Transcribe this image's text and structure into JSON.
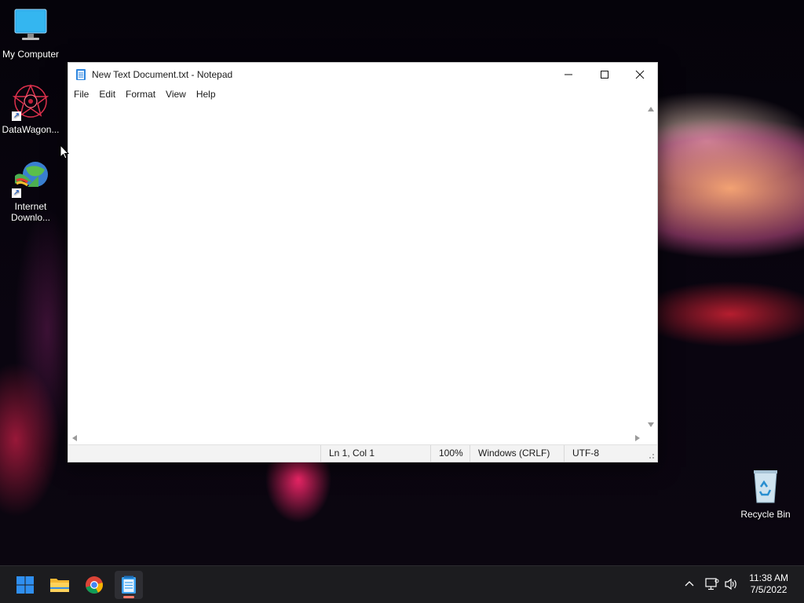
{
  "desktop": {
    "icons": [
      {
        "label": "My Computer",
        "icon": "monitor-icon"
      },
      {
        "label": "DataWagon...",
        "icon": "datawagon-icon"
      },
      {
        "label": "Internet Downlo...",
        "icon": "internet-download-manager-icon"
      },
      {
        "label": "Recycle Bin",
        "icon": "recycle-bin-icon"
      }
    ]
  },
  "notepad": {
    "title": "New Text Document.txt - Notepad",
    "menu": [
      "File",
      "Edit",
      "Format",
      "View",
      "Help"
    ],
    "content": "",
    "status": {
      "position": "Ln 1, Col 1",
      "zoom": "100%",
      "line_ending": "Windows (CRLF)",
      "encoding": "UTF-8"
    }
  },
  "taskbar": {
    "apps": [
      "start-icon",
      "file-explorer-icon",
      "chrome-icon",
      "notepad-icon"
    ],
    "active_app": "notepad-icon",
    "time": "11:38 AM",
    "date": "7/5/2022"
  },
  "colors": {
    "taskbar_bg": "#1c1c1f",
    "active_indicator": "#ff7b6b",
    "start_blue": "#2f8ff0"
  }
}
